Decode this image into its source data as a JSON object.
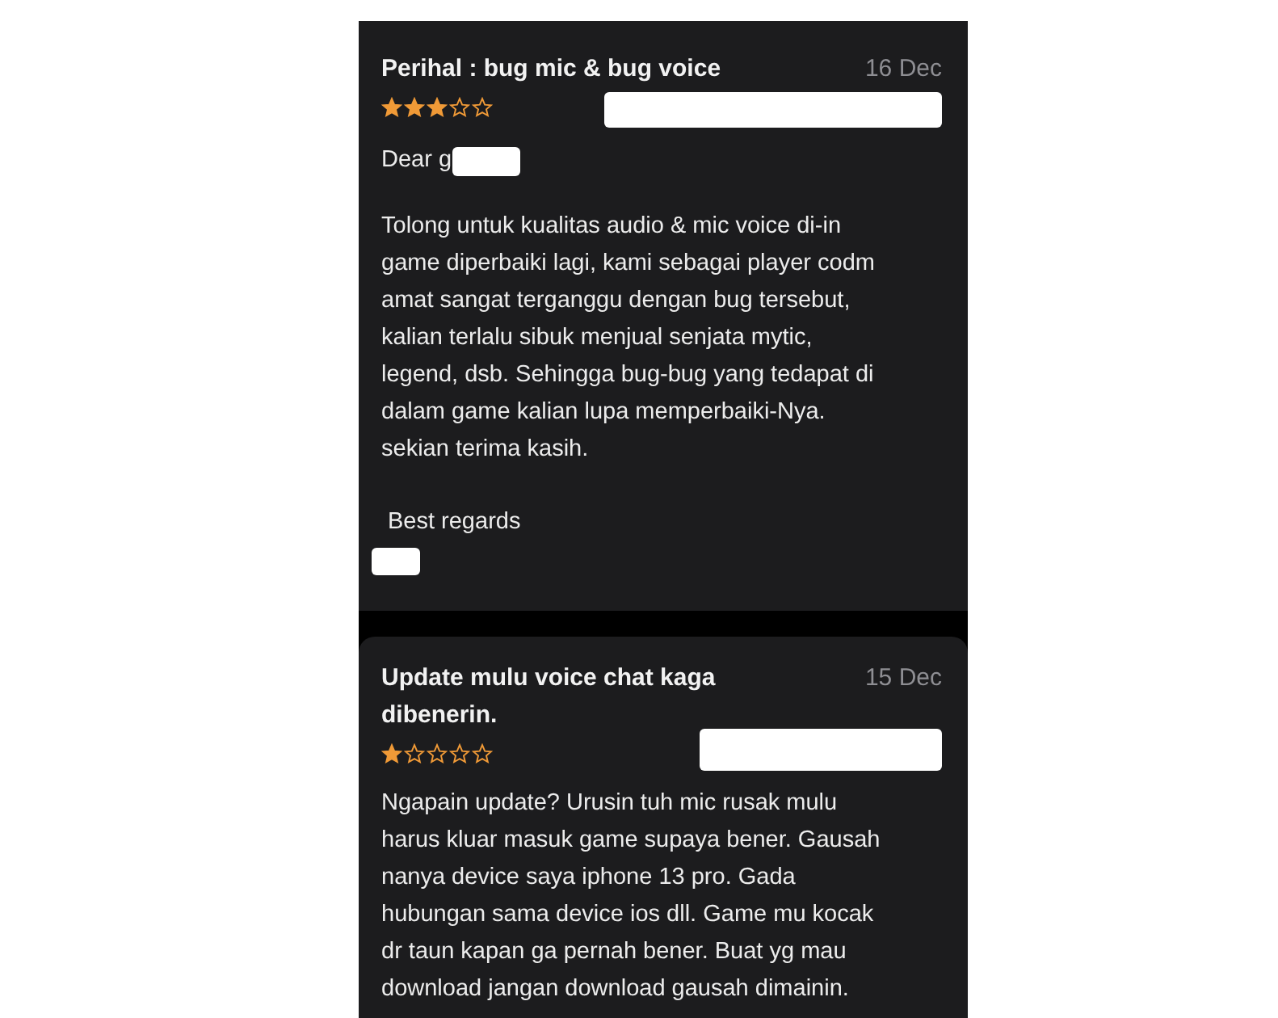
{
  "reviews": [
    {
      "title": "Perihal : bug mic & bug voice",
      "date": "16 Dec",
      "stars": 3,
      "greeting": "Dear g",
      "body": "Tolong untuk kualitas audio & mic voice di-in\ngame diperbaiki lagi, kami sebagai player codm\namat sangat terganggu dengan bug tersebut,\nkalian terlalu sibuk menjual senjata mytic,\nlegend, dsb. Sehingga bug-bug yang tedapat di\ndalam game kalian lupa memperbaiki-Nya.\nsekian terima kasih.",
      "closing": "Best regards"
    },
    {
      "title": "Update mulu voice chat kaga\ndibenerin.",
      "date": "15 Dec",
      "stars": 1,
      "body": "Ngapain update? Urusin tuh mic rusak mulu\nharus kluar masuk game supaya bener. Gausah\nnanya device saya iphone 13 pro. Gada\nhubungan sama device ios dll. Game mu kocak\ndr taun kapan ga pernah bener. Buat yg mau\ndownload jangan download gausah dimainin."
    }
  ]
}
